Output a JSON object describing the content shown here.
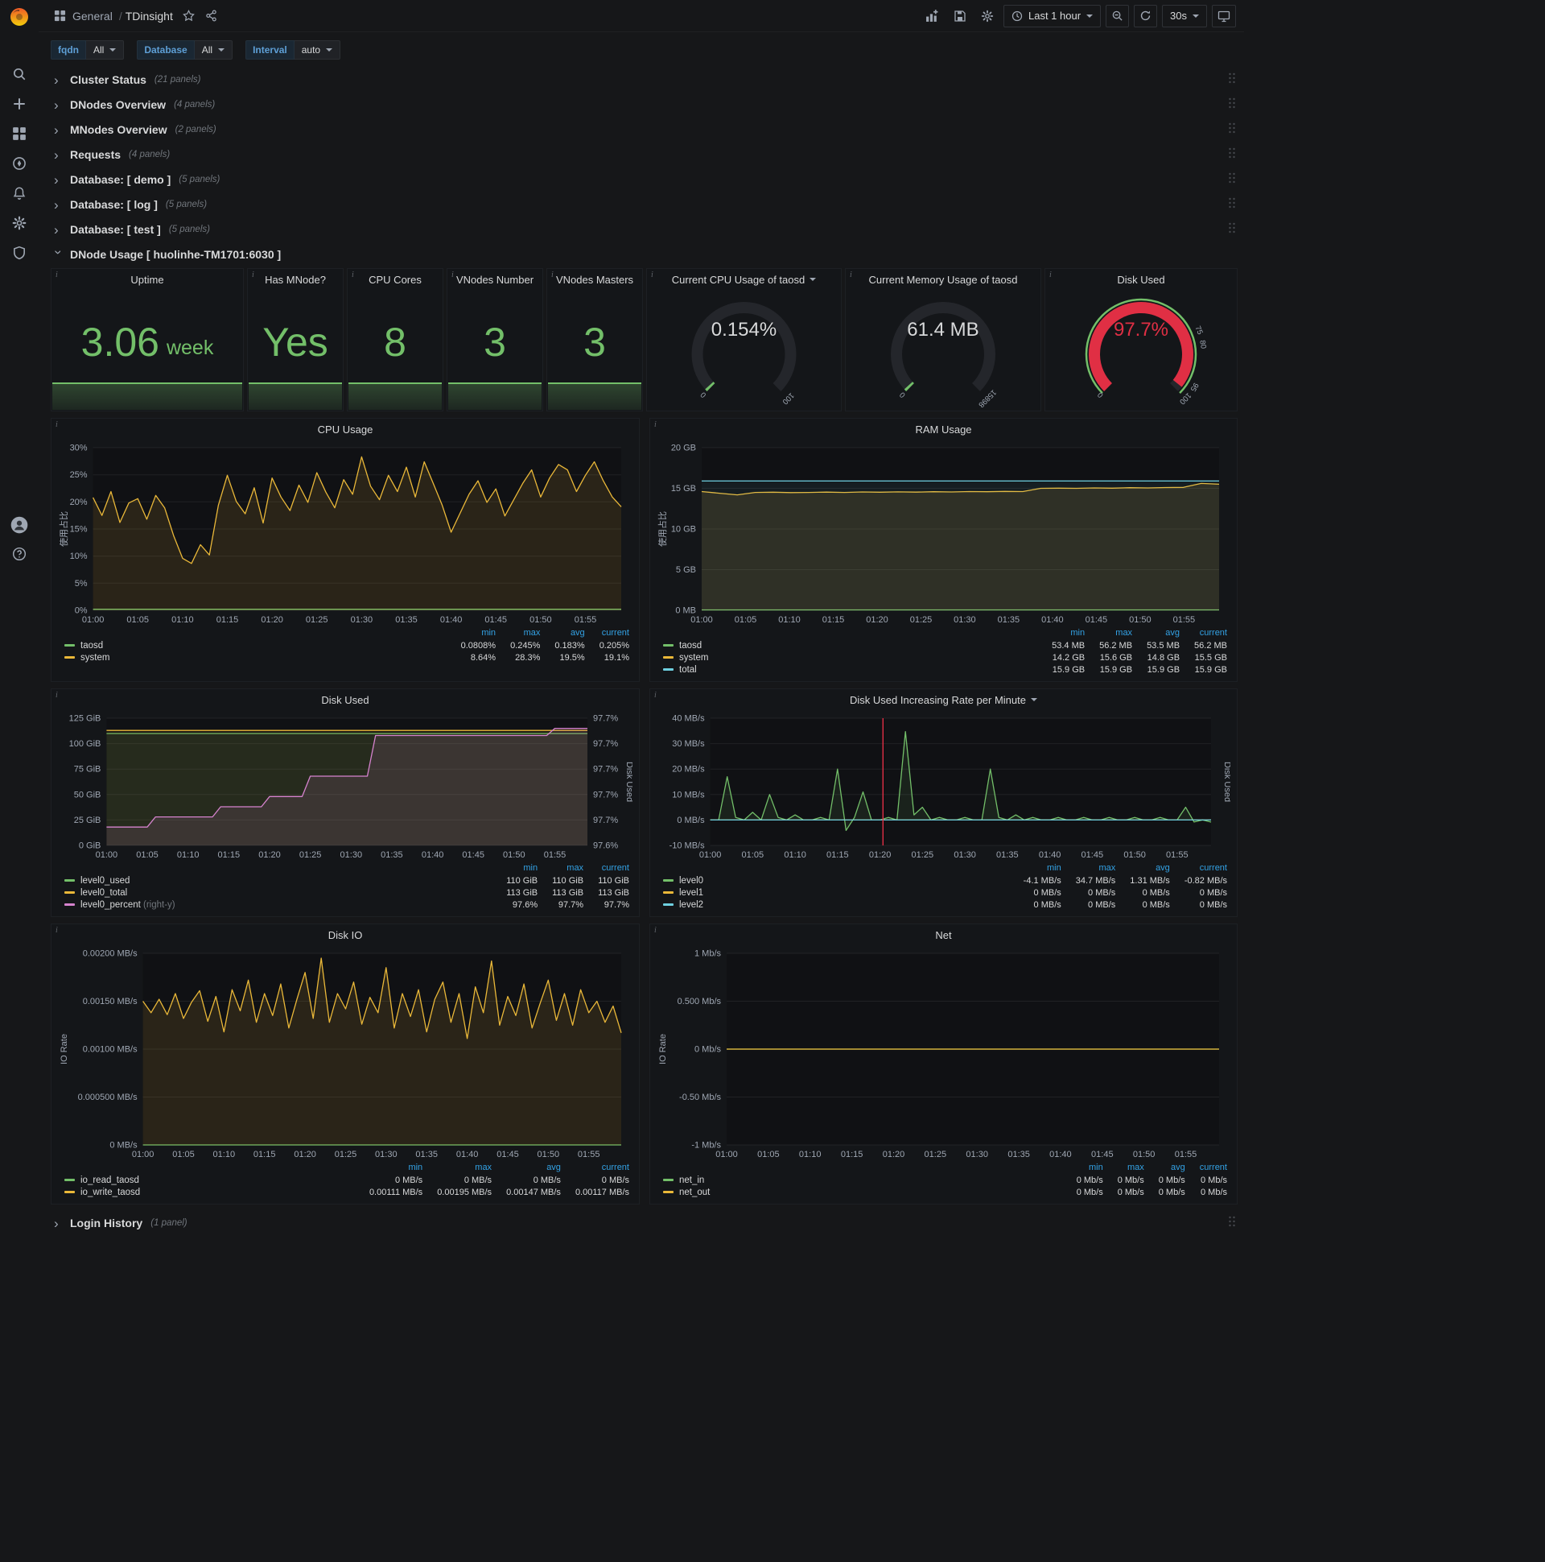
{
  "ui": {
    "info_glyph": "i",
    "help_glyph": "?",
    "chevron": "›",
    "separator": "/"
  },
  "colors": {
    "page_bg": "#161719",
    "panel_bg": "#141619",
    "green": "#73bf69",
    "yellow": "#eab839",
    "blue": "#6ed0e0",
    "pink": "#d683ce",
    "red": "#e02f44",
    "legend_header_blue": "#33a2e5"
  },
  "navbar": {
    "section": "General",
    "title": "TDinsight",
    "time_range": "Last 1 hour",
    "refresh": "30s"
  },
  "variables": [
    {
      "label": "fqdn",
      "value": "All"
    },
    {
      "label": "Database",
      "value": "All"
    },
    {
      "label": "Interval",
      "value": "auto"
    }
  ],
  "rows": [
    {
      "title": "Cluster Status",
      "count": "(21 panels)"
    },
    {
      "title": "DNodes Overview",
      "count": "(4 panels)"
    },
    {
      "title": "MNodes Overview",
      "count": "(2 panels)"
    },
    {
      "title": "Requests",
      "count": "(4 panels)"
    },
    {
      "title": "Database: [ demo ]",
      "count": "(5 panels)"
    },
    {
      "title": "Database: [ log ]",
      "count": "(5 panels)"
    },
    {
      "title": "Database: [ test ]",
      "count": "(5 panels)"
    }
  ],
  "expanded_row": {
    "title": "DNode Usage [ huolinhe-TM1701:6030 ]"
  },
  "bottom_row": {
    "title": "Login History",
    "count": "(1 panel)"
  },
  "stats": [
    {
      "title": "Uptime",
      "value": "3.06",
      "unit": "week"
    },
    {
      "title": "Has MNode?",
      "value": "Yes",
      "unit": ""
    },
    {
      "title": "CPU Cores",
      "value": "8",
      "unit": ""
    },
    {
      "title": "VNodes Number",
      "value": "3",
      "unit": ""
    },
    {
      "title": "VNodes Masters",
      "value": "3",
      "unit": ""
    }
  ],
  "gauges": [
    {
      "title": "Current CPU Usage of taosd",
      "value": "0.154%",
      "pct": 0.00154,
      "min": "0",
      "max": "100",
      "arc_color": "#73bf69",
      "value_color": "#d8d9da",
      "thresholds": []
    },
    {
      "title": "Current Memory Usage of taosd",
      "value": "61.4 MB",
      "pct": 0.0039,
      "min": "0",
      "max": "15898",
      "arc_color": "#73bf69",
      "value_color": "#d8d9da",
      "thresholds": []
    },
    {
      "title": "Disk Used",
      "value": "97.7%",
      "pct": 0.977,
      "min": "0",
      "max": "100",
      "arc_color": "#e02f44",
      "value_color": "#e02f44",
      "outer_ring": "#73bf69",
      "thresholds": [
        {
          "v": 75,
          "label": "75"
        },
        {
          "v": 80,
          "label": "80"
        },
        {
          "v": 95,
          "label": "95"
        }
      ]
    }
  ],
  "chart_data": [
    {
      "type": "line",
      "title": "CPU Usage",
      "ylabel": "使用占比",
      "ylim": [
        0,
        30
      ],
      "yticks": [
        {
          "v": 0,
          "label": "0%"
        },
        {
          "v": 5,
          "label": "5%"
        },
        {
          "v": 10,
          "label": "10%"
        },
        {
          "v": 15,
          "label": "15%"
        },
        {
          "v": 20,
          "label": "20%"
        },
        {
          "v": 25,
          "label": "25%"
        },
        {
          "v": 30,
          "label": "30%"
        }
      ],
      "x_labels": [
        "01:00",
        "01:05",
        "01:10",
        "01:15",
        "01:20",
        "01:25",
        "01:30",
        "01:35",
        "01:40",
        "01:45",
        "01:50",
        "01:55"
      ],
      "series": [
        {
          "name": "taosd",
          "color": "#73bf69",
          "fill": 0.06,
          "values": [
            0.2,
            0.2
          ]
        },
        {
          "name": "system",
          "color": "#eab839",
          "fill": 0.12,
          "values": [
            20.8,
            17.5,
            21.9,
            16.2,
            19.8,
            20.6,
            16.8,
            21.2,
            18.9,
            13.8,
            9.6,
            8.64,
            12.1,
            10.2,
            19.4,
            24.9,
            20.1,
            17.8,
            22.6,
            16.1,
            24.4,
            20.9,
            18.4,
            23.1,
            19.9,
            25.4,
            21.8,
            18.9,
            24.1,
            21.4,
            28.3,
            22.9,
            20.4,
            24.9,
            21.9,
            26.4,
            20.9,
            27.4,
            23.4,
            19.4,
            14.4,
            17.9,
            21.4,
            23.9,
            19.9,
            22.4,
            17.4,
            20.4,
            23.4,
            25.9,
            20.9,
            24.4,
            26.9,
            25.9,
            21.9,
            24.9,
            27.4,
            23.9,
            20.9,
            19.1
          ]
        }
      ],
      "legend": {
        "columns": [
          "min",
          "max",
          "avg",
          "current"
        ],
        "rows": [
          {
            "name": "taosd",
            "color": "#73bf69",
            "values": [
              "0.0808%",
              "0.245%",
              "0.183%",
              "0.205%"
            ]
          },
          {
            "name": "system",
            "color": "#eab839",
            "values": [
              "8.64%",
              "28.3%",
              "19.5%",
              "19.1%"
            ]
          }
        ]
      }
    },
    {
      "type": "line",
      "title": "RAM Usage",
      "ylabel": "使用占比",
      "ylim": [
        0,
        20
      ],
      "yticks": [
        {
          "v": 0,
          "label": "0 MB"
        },
        {
          "v": 5,
          "label": "5 GB"
        },
        {
          "v": 10,
          "label": "10 GB"
        },
        {
          "v": 15,
          "label": "15 GB"
        },
        {
          "v": 20,
          "label": "20 GB"
        }
      ],
      "x_labels": [
        "01:00",
        "01:05",
        "01:10",
        "01:15",
        "01:20",
        "01:25",
        "01:30",
        "01:35",
        "01:40",
        "01:45",
        "01:50",
        "01:55"
      ],
      "series": [
        {
          "name": "taosd",
          "color": "#73bf69",
          "fill": 0.08,
          "values": [
            0.054,
            0.054
          ]
        },
        {
          "name": "system",
          "color": "#eab839",
          "fill": 0.12,
          "values": [
            14.6,
            14.4,
            14.2,
            14.5,
            14.52,
            14.48,
            14.5,
            14.53,
            14.5,
            14.55,
            14.52,
            14.56,
            14.53,
            14.58,
            14.55,
            14.6,
            14.58,
            14.62,
            14.6,
            15.0,
            15.02,
            15.0,
            15.05,
            15.02,
            15.08,
            15.05,
            15.1,
            15.12,
            15.6,
            15.5
          ]
        },
        {
          "name": "total",
          "color": "#6ed0e0",
          "fill": 0.07,
          "values": [
            15.9,
            15.9
          ]
        }
      ],
      "legend": {
        "columns": [
          "min",
          "max",
          "avg",
          "current"
        ],
        "rows": [
          {
            "name": "taosd",
            "color": "#73bf69",
            "values": [
              "53.4 MB",
              "56.2 MB",
              "53.5 MB",
              "56.2 MB"
            ]
          },
          {
            "name": "system",
            "color": "#eab839",
            "values": [
              "14.2 GB",
              "15.6 GB",
              "14.8 GB",
              "15.5 GB"
            ]
          },
          {
            "name": "total",
            "color": "#6ed0e0",
            "values": [
              "15.9 GB",
              "15.9 GB",
              "15.9 GB",
              "15.9 GB"
            ]
          }
        ]
      }
    },
    {
      "type": "line",
      "title": "Disk Used",
      "ylim": [
        0,
        125
      ],
      "yticks": [
        {
          "v": 0,
          "label": "0 GiB"
        },
        {
          "v": 25,
          "label": "25 GiB"
        },
        {
          "v": 50,
          "label": "50 GiB"
        },
        {
          "v": 75,
          "label": "75 GiB"
        },
        {
          "v": 100,
          "label": "100 GiB"
        },
        {
          "v": 125,
          "label": "125 GiB"
        }
      ],
      "right_ylim": [
        97.6,
        97.725
      ],
      "right_yticks": [
        "97.6%",
        "97.7%",
        "97.7%",
        "97.7%",
        "97.7%",
        "97.7%"
      ],
      "right_ylabel": "Disk Used",
      "x_labels": [
        "01:00",
        "01:05",
        "01:10",
        "01:15",
        "01:20",
        "01:25",
        "01:30",
        "01:35",
        "01:40",
        "01:45",
        "01:50",
        "01:55"
      ],
      "series": [
        {
          "name": "level0_used",
          "color": "#73bf69",
          "fill": 0.1,
          "values": [
            110,
            110
          ]
        },
        {
          "name": "level0_total",
          "color": "#eab839",
          "fill": 0.06,
          "values": [
            113,
            113
          ]
        },
        {
          "name": "level0_percent",
          "color": "#d683ce",
          "fill": 0.12,
          "axis": "right",
          "values": [
            97.618,
            97.618,
            97.618,
            97.618,
            97.618,
            97.618,
            97.628,
            97.628,
            97.628,
            97.628,
            97.628,
            97.628,
            97.628,
            97.628,
            97.638,
            97.638,
            97.638,
            97.638,
            97.638,
            97.638,
            97.648,
            97.648,
            97.648,
            97.648,
            97.648,
            97.668,
            97.668,
            97.668,
            97.668,
            97.668,
            97.668,
            97.668,
            97.668,
            97.708,
            97.708,
            97.708,
            97.708,
            97.708,
            97.708,
            97.708,
            97.708,
            97.708,
            97.708,
            97.708,
            97.708,
            97.708,
            97.708,
            97.708,
            97.708,
            97.708,
            97.708,
            97.708,
            97.708,
            97.708,
            97.708,
            97.715,
            97.715,
            97.715,
            97.715,
            97.715
          ]
        }
      ],
      "legend": {
        "columns": [
          "min",
          "max",
          "current"
        ],
        "rows": [
          {
            "name": "level0_used",
            "color": "#73bf69",
            "values": [
              "110 GiB",
              "110 GiB",
              "110 GiB"
            ]
          },
          {
            "name": "level0_total",
            "color": "#eab839",
            "values": [
              "113 GiB",
              "113 GiB",
              "113 GiB"
            ]
          },
          {
            "name": "level0_percent",
            "suffix": "(right-y)",
            "color": "#d683ce",
            "values": [
              "97.6%",
              "97.7%",
              "97.7%"
            ]
          }
        ]
      }
    },
    {
      "type": "line",
      "title": "Disk Used Increasing Rate per Minute",
      "caret": true,
      "ylim": [
        -10,
        40
      ],
      "yticks": [
        {
          "v": -10,
          "label": "-10 MB/s"
        },
        {
          "v": 0,
          "label": "0 MB/s"
        },
        {
          "v": 10,
          "label": "10 MB/s"
        },
        {
          "v": 20,
          "label": "20 MB/s"
        },
        {
          "v": 30,
          "label": "30 MB/s"
        },
        {
          "v": 40,
          "label": "40 MB/s"
        }
      ],
      "right_ylabel": "Disk Used",
      "annotation_x_frac": 0.345,
      "x_labels": [
        "01:00",
        "01:05",
        "01:10",
        "01:15",
        "01:20",
        "01:25",
        "01:30",
        "01:35",
        "01:40",
        "01:45",
        "01:50",
        "01:55"
      ],
      "series": [
        {
          "name": "level0",
          "color": "#73bf69",
          "fill": 0.1,
          "values": [
            0,
            0,
            17,
            1,
            0,
            3,
            0,
            10,
            1,
            0,
            2,
            0,
            0,
            1,
            0,
            20,
            -4.1,
            1,
            11,
            0,
            0,
            1,
            0,
            34.7,
            2,
            5,
            0,
            1,
            0,
            0,
            1,
            0,
            0,
            20,
            1,
            0,
            2,
            0,
            1,
            0,
            0,
            1,
            0,
            0,
            1,
            0,
            0,
            1,
            0,
            0,
            1,
            0,
            0,
            1,
            0,
            0,
            5,
            -0.8,
            0,
            -0.82
          ]
        },
        {
          "name": "level1",
          "color": "#eab839",
          "fill": 0,
          "values": [
            0,
            0
          ]
        },
        {
          "name": "level2",
          "color": "#6ed0e0",
          "fill": 0,
          "values": [
            0,
            0
          ]
        }
      ],
      "legend": {
        "columns": [
          "min",
          "max",
          "avg",
          "current"
        ],
        "rows": [
          {
            "name": "level0",
            "color": "#73bf69",
            "values": [
              "-4.1 MB/s",
              "34.7 MB/s",
              "1.31 MB/s",
              "-0.82 MB/s"
            ]
          },
          {
            "name": "level1",
            "color": "#eab839",
            "values": [
              "0 MB/s",
              "0 MB/s",
              "0 MB/s",
              "0 MB/s"
            ]
          },
          {
            "name": "level2",
            "color": "#6ed0e0",
            "values": [
              "0 MB/s",
              "0 MB/s",
              "0 MB/s",
              "0 MB/s"
            ]
          }
        ]
      }
    },
    {
      "type": "line",
      "title": "Disk IO",
      "ylabel": "IO Rate",
      "ylim": [
        0,
        0.002
      ],
      "yticks": [
        {
          "v": 0,
          "label": "0 MB/s"
        },
        {
          "v": 0.0005,
          "label": "0.000500 MB/s"
        },
        {
          "v": 0.001,
          "label": "0.00100 MB/s"
        },
        {
          "v": 0.0015,
          "label": "0.00150 MB/s"
        },
        {
          "v": 0.002,
          "label": "0.00200 MB/s"
        }
      ],
      "x_labels": [
        "01:00",
        "01:05",
        "01:10",
        "01:15",
        "01:20",
        "01:25",
        "01:30",
        "01:35",
        "01:40",
        "01:45",
        "01:50",
        "01:55"
      ],
      "series": [
        {
          "name": "io_read_taosd",
          "color": "#73bf69",
          "fill": 0.08,
          "values": [
            0,
            0
          ]
        },
        {
          "name": "io_write_taosd",
          "color": "#eab839",
          "fill": 0.12,
          "values": [
            0.0015,
            0.00138,
            0.00152,
            0.00136,
            0.00158,
            0.00132,
            0.00149,
            0.00161,
            0.00129,
            0.00155,
            0.00118,
            0.00162,
            0.0014,
            0.00172,
            0.00128,
            0.00158,
            0.00135,
            0.00168,
            0.00122,
            0.00152,
            0.0018,
            0.00132,
            0.00195,
            0.00128,
            0.00158,
            0.00142,
            0.0017,
            0.00126,
            0.00154,
            0.00138,
            0.00185,
            0.00122,
            0.00158,
            0.00134,
            0.00162,
            0.00118,
            0.00152,
            0.0017,
            0.00128,
            0.00158,
            0.00111,
            0.00165,
            0.00138,
            0.00192,
            0.00125,
            0.00155,
            0.00135,
            0.00168,
            0.00122,
            0.00148,
            0.00172,
            0.0013,
            0.00158,
            0.00125,
            0.00162,
            0.00138,
            0.0015,
            0.00128,
            0.00145,
            0.00117
          ]
        }
      ],
      "legend": {
        "columns": [
          "min",
          "max",
          "avg",
          "current"
        ],
        "rows": [
          {
            "name": "io_read_taosd",
            "color": "#73bf69",
            "values": [
              "0 MB/s",
              "0 MB/s",
              "0 MB/s",
              "0 MB/s"
            ]
          },
          {
            "name": "io_write_taosd",
            "color": "#eab839",
            "values": [
              "0.00111 MB/s",
              "0.00195 MB/s",
              "0.00147 MB/s",
              "0.00117 MB/s"
            ]
          }
        ]
      }
    },
    {
      "type": "line",
      "title": "Net",
      "ylabel": "IO Rate",
      "ylim": [
        -1,
        1
      ],
      "yticks": [
        {
          "v": -1,
          "label": "-1 Mb/s"
        },
        {
          "v": -0.5,
          "label": "-0.50 Mb/s"
        },
        {
          "v": 0,
          "label": "0 Mb/s"
        },
        {
          "v": 0.5,
          "label": "0.500 Mb/s"
        },
        {
          "v": 1,
          "label": "1 Mb/s"
        }
      ],
      "x_labels": [
        "01:00",
        "01:05",
        "01:10",
        "01:15",
        "01:20",
        "01:25",
        "01:30",
        "01:35",
        "01:40",
        "01:45",
        "01:50",
        "01:55"
      ],
      "series": [
        {
          "name": "net_in",
          "color": "#73bf69",
          "fill": 0,
          "values": [
            0,
            0
          ]
        },
        {
          "name": "net_out",
          "color": "#eab839",
          "fill": 0,
          "values": [
            0,
            0
          ]
        }
      ],
      "legend": {
        "columns": [
          "min",
          "max",
          "avg",
          "current"
        ],
        "rows": [
          {
            "name": "net_in",
            "color": "#73bf69",
            "values": [
              "0 Mb/s",
              "0 Mb/s",
              "0 Mb/s",
              "0 Mb/s"
            ]
          },
          {
            "name": "net_out",
            "color": "#eab839",
            "values": [
              "0 Mb/s",
              "0 Mb/s",
              "0 Mb/s",
              "0 Mb/s"
            ]
          }
        ]
      }
    }
  ]
}
